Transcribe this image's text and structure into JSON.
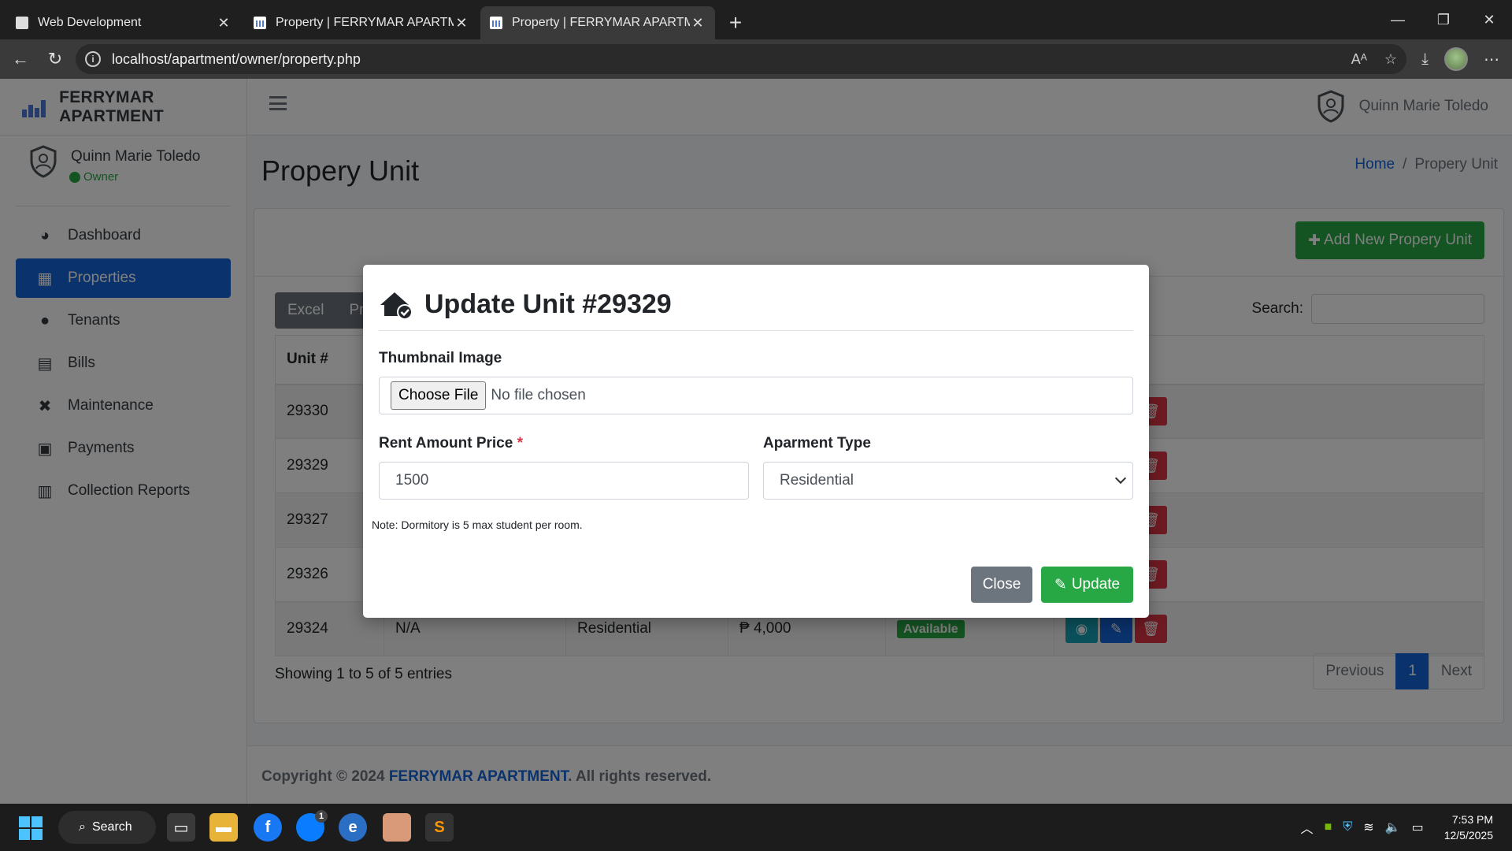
{
  "browser": {
    "tabs": [
      {
        "title": "Web Development",
        "active": false
      },
      {
        "title": "Property | FERRYMAR APARTMENT",
        "active": false
      },
      {
        "title": "Property | FERRYMAR APARTMENT",
        "active": true
      }
    ],
    "url": "localhost/apartment/owner/property.php"
  },
  "app": {
    "brand": "FERRYMAR APARTMENT",
    "user": {
      "name": "Quinn Marie Toledo",
      "role": "Owner"
    },
    "nav": [
      {
        "label": "Dashboard",
        "icon": "dashboard-icon",
        "active": false
      },
      {
        "label": "Properties",
        "icon": "building-icon",
        "active": true
      },
      {
        "label": "Tenants",
        "icon": "user-icon",
        "active": false
      },
      {
        "label": "Bills",
        "icon": "bill-icon",
        "active": false
      },
      {
        "label": "Maintenance",
        "icon": "tools-icon",
        "active": false
      },
      {
        "label": "Payments",
        "icon": "money-icon",
        "active": false
      },
      {
        "label": "Collection Reports",
        "icon": "chart-icon",
        "active": false
      }
    ]
  },
  "page": {
    "title": "Propery Unit",
    "breadcrumb": {
      "home": "Home",
      "sep": "/",
      "current": "Propery Unit"
    },
    "add_button": "Add New Propery Unit",
    "export_buttons": [
      "Excel",
      "Pri"
    ],
    "search_label": "Search:",
    "table": {
      "header_unit": "Unit #",
      "rows": [
        {
          "unit": "29330",
          "image": "",
          "type": "",
          "price": "",
          "status": ""
        },
        {
          "unit": "29329",
          "image": "",
          "type": "",
          "price": "",
          "status": ""
        },
        {
          "unit": "29327",
          "image": "",
          "type": "",
          "price": "",
          "status": ""
        },
        {
          "unit": "29326",
          "image": "",
          "type": "",
          "price": "",
          "status": ""
        },
        {
          "unit": "29324",
          "image": "N/A",
          "type": "Residential",
          "price": "₱ 4,000",
          "status": "Available"
        }
      ]
    },
    "showing": "Showing 1 to 5 of 5 entries",
    "pagination": {
      "previous": "Previous",
      "current": "1",
      "next": "Next"
    },
    "footer": {
      "prefix": "Copyright © 2024 ",
      "brand": "FERRYMAR APARTMENT",
      "suffix": ". All rights reserved."
    }
  },
  "modal": {
    "title": "Update Unit #29329",
    "thumbnail_label": "Thumbnail Image",
    "choose_file": "Choose File",
    "no_file": "No file chosen",
    "rent_label": "Rent Amount Price",
    "required_mark": "*",
    "rent_value": "1500",
    "type_label": "Aparment Type",
    "type_value": "Residential",
    "note": "Note: Dormitory is 5 max student per room.",
    "close_button": "Close",
    "update_button": "Update"
  },
  "taskbar": {
    "search": "Search",
    "time": "7:53 PM",
    "date": "12/5/2025",
    "messenger_badge": "1"
  },
  "colors": {
    "primary": "#1565d8",
    "success": "#28a745",
    "danger": "#dc3545",
    "info": "#17a2b8",
    "secondary": "#6c757d"
  }
}
